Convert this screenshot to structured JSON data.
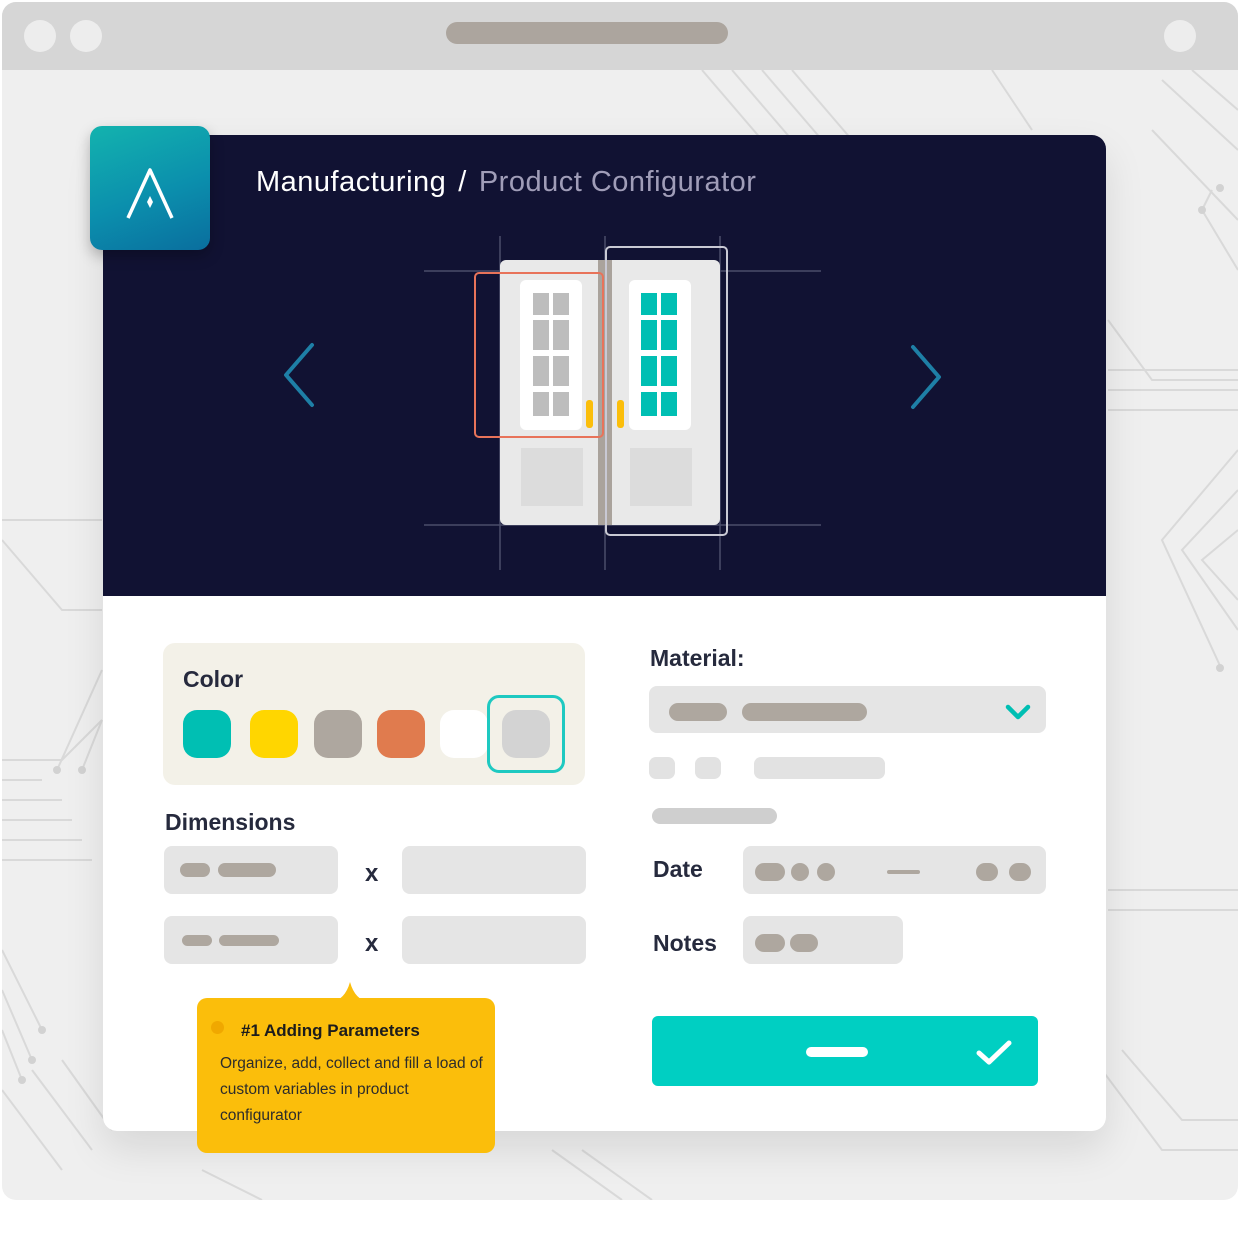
{
  "header": {
    "breadcrumb": {
      "section": "Manufacturing",
      "separator": "/",
      "current": "Product Configurator"
    },
    "logo_icon": "aceik-logo-icon",
    "prev_icon": "chevron-left-icon",
    "next_icon": "chevron-right-icon"
  },
  "form": {
    "color": {
      "label": "Color",
      "swatches": [
        "#00bfb3",
        "#ffd600",
        "#aea79f",
        "#e07b4e",
        "#ffffff",
        "#d3d3d3"
      ],
      "selected_index": 5
    },
    "dimensions": {
      "label": "Dimensions",
      "separator": "x"
    },
    "material": {
      "label": "Material:",
      "dropdown_icon": "chevron-down-icon"
    },
    "date": {
      "label": "Date"
    },
    "notes": {
      "label": "Notes"
    },
    "submit": {
      "icon": "check-icon"
    }
  },
  "tooltip": {
    "title": "#1  Adding Parameters",
    "text": "Organize, add, collect and fill a load of custom variables in product configurator"
  },
  "colors": {
    "accent": "#00cfc2",
    "hero_background": "#111233",
    "tooltip_background": "#fbbe0b",
    "highlight_frame": "#e8735a"
  }
}
